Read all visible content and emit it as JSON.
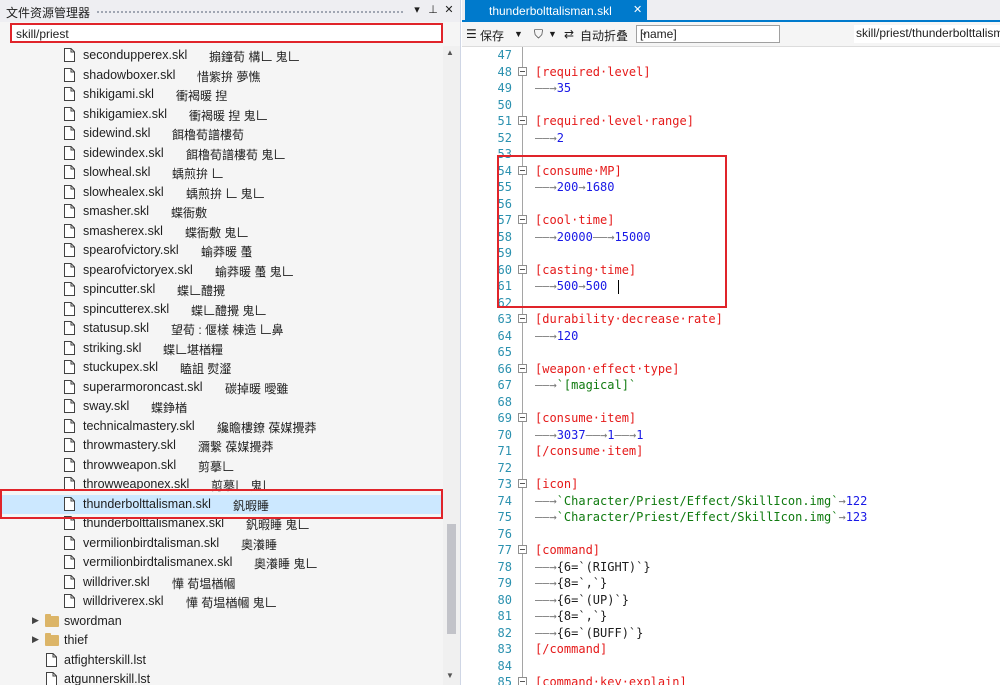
{
  "left_panel": {
    "title": "文件资源管理器",
    "search_text": "skill/priest",
    "pin_icon": "pin-icon",
    "close_icon": "close-icon",
    "items": [
      {
        "name": "secondupperex.skl",
        "desc": "搧鐘荀 構𠃊 鬼𠃊"
      },
      {
        "name": "shadowboxer.skl",
        "desc": "惜紫拚 夢憔"
      },
      {
        "name": "shikigami.skl",
        "desc": "衝褐暖 揑"
      },
      {
        "name": "shikigamiex.skl",
        "desc": "衝褐暖 揑 鬼𠃊"
      },
      {
        "name": "sidewind.skl",
        "desc": "餌橹荀譜樓荀"
      },
      {
        "name": "sidewindex.skl",
        "desc": "餌橹荀譜樓荀 鬼𠃊"
      },
      {
        "name": "slowheal.skl",
        "desc": "蝺煎拚 𠃊"
      },
      {
        "name": "slowhealex.skl",
        "desc": "蝺煎拚 𠃊 鬼𠃊"
      },
      {
        "name": "smasher.skl",
        "desc": "蝶衙敷"
      },
      {
        "name": "smasherex.skl",
        "desc": "蝶衙敷 鬼𠃊"
      },
      {
        "name": "spearofvictory.skl",
        "desc": "蝓莽暖 蠆"
      },
      {
        "name": "spearofvictoryex.skl",
        "desc": "蝓莽暖 蠆 鬼𠃊"
      },
      {
        "name": "spincutter.skl",
        "desc": "蝶𠃊醴攪"
      },
      {
        "name": "spincutterex.skl",
        "desc": "蝶𠃊醴攪 鬼𠃊"
      },
      {
        "name": "statusup.skl",
        "desc": "望荀 : 偃樣 棟造 𠃊鼻"
      },
      {
        "name": "striking.skl",
        "desc": "蝶𠃊堪楢糧"
      },
      {
        "name": "stuckupex.skl",
        "desc": "瞌詛 熨瀣"
      },
      {
        "name": "superarmoroncast.skl",
        "desc": "碳掉暖 曖雖"
      },
      {
        "name": "sway.skl",
        "desc": "蝶錚楢"
      },
      {
        "name": "technicalmastery.skl",
        "desc": "纔瞻樓鐐 葆媒攪莽"
      },
      {
        "name": "throwmastery.skl",
        "desc": "瀰繫 葆媒攪莽"
      },
      {
        "name": "throwweapon.skl",
        "desc": "剪摹𠃊"
      },
      {
        "name": "throwweaponex.skl",
        "desc": "剪摹𠃊 鬼𠃊"
      },
      {
        "name": "thunderbolttalisman.skl",
        "desc": "釩暇睡"
      },
      {
        "name": "thunderbolttalismanex.skl",
        "desc": "釩暇睡 鬼𠃊"
      },
      {
        "name": "vermilionbirdtalisman.skl",
        "desc": "奧瀁睡"
      },
      {
        "name": "vermilionbirdtalismanex.skl",
        "desc": "奧瀁睡 鬼𠃊"
      },
      {
        "name": "willdriver.skl",
        "desc": "㦊 荀塭楢幗"
      },
      {
        "name": "willdriverex.skl",
        "desc": "㦊 荀塭楢幗 鬼𠃊"
      }
    ],
    "folders": [
      "swordman",
      "thief"
    ],
    "files_after": [
      "atfighterskill.lst",
      "atgunnerskill.lst"
    ]
  },
  "right_panel": {
    "tab_title": "thunderbolttalisman.skl",
    "tab_close_icon": "close-icon",
    "toolbar": {
      "save_label": "保存",
      "filter_icon": "filter-icon",
      "auto_fold_label": "自动折叠",
      "name_select_value": "[name]",
      "path": "skill/priest/thunderbolttalisman"
    },
    "lines": [
      {
        "n": "47",
        "fold": false,
        "tokens": []
      },
      {
        "n": "48",
        "fold": true,
        "tokens": [
          {
            "t": "[required·level]",
            "c": "kw"
          }
        ]
      },
      {
        "n": "49",
        "fold": false,
        "tokens": [
          {
            "t": "——→",
            "c": "ws"
          },
          {
            "t": "35",
            "c": "num"
          }
        ]
      },
      {
        "n": "50",
        "fold": false,
        "tokens": []
      },
      {
        "n": "51",
        "fold": true,
        "tokens": [
          {
            "t": "[required·level·range]",
            "c": "kw"
          }
        ]
      },
      {
        "n": "52",
        "fold": false,
        "tokens": [
          {
            "t": "——→",
            "c": "ws"
          },
          {
            "t": "2",
            "c": "num"
          }
        ]
      },
      {
        "n": "53",
        "fold": false,
        "tokens": []
      },
      {
        "n": "54",
        "fold": true,
        "tokens": [
          {
            "t": "[consume·MP]",
            "c": "kw"
          }
        ]
      },
      {
        "n": "55",
        "fold": false,
        "tokens": [
          {
            "t": "——→",
            "c": "ws"
          },
          {
            "t": "200",
            "c": "num"
          },
          {
            "t": "→",
            "c": "ws"
          },
          {
            "t": "1680",
            "c": "num"
          }
        ]
      },
      {
        "n": "56",
        "fold": false,
        "tokens": []
      },
      {
        "n": "57",
        "fold": true,
        "tokens": [
          {
            "t": "[cool·time]",
            "c": "kw"
          }
        ]
      },
      {
        "n": "58",
        "fold": false,
        "tokens": [
          {
            "t": "——→",
            "c": "ws"
          },
          {
            "t": "20000",
            "c": "num"
          },
          {
            "t": "——→",
            "c": "ws"
          },
          {
            "t": "15000",
            "c": "num"
          }
        ]
      },
      {
        "n": "59",
        "fold": false,
        "tokens": []
      },
      {
        "n": "60",
        "fold": true,
        "tokens": [
          {
            "t": "[casting·time]",
            "c": "kw"
          }
        ]
      },
      {
        "n": "61",
        "fold": false,
        "tokens": [
          {
            "t": "——→",
            "c": "ws"
          },
          {
            "t": "500",
            "c": "num"
          },
          {
            "t": "→",
            "c": "ws"
          },
          {
            "t": "500",
            "c": "num"
          }
        ]
      },
      {
        "n": "62",
        "fold": false,
        "tokens": []
      },
      {
        "n": "63",
        "fold": true,
        "tokens": [
          {
            "t": "[durability·decrease·rate]",
            "c": "kw"
          }
        ]
      },
      {
        "n": "64",
        "fold": false,
        "tokens": [
          {
            "t": "——→",
            "c": "ws"
          },
          {
            "t": "120",
            "c": "num"
          }
        ]
      },
      {
        "n": "65",
        "fold": false,
        "tokens": []
      },
      {
        "n": "66",
        "fold": true,
        "tokens": [
          {
            "t": "[weapon·effect·type]",
            "c": "kw"
          }
        ]
      },
      {
        "n": "67",
        "fold": false,
        "tokens": [
          {
            "t": "——→",
            "c": "ws"
          },
          {
            "t": "`[magical]`",
            "c": "str"
          }
        ]
      },
      {
        "n": "68",
        "fold": false,
        "tokens": []
      },
      {
        "n": "69",
        "fold": true,
        "tokens": [
          {
            "t": "[consume·item]",
            "c": "kw"
          }
        ]
      },
      {
        "n": "70",
        "fold": false,
        "tokens": [
          {
            "t": "——→",
            "c": "ws"
          },
          {
            "t": "3037",
            "c": "num"
          },
          {
            "t": "——→",
            "c": "ws"
          },
          {
            "t": "1",
            "c": "num"
          },
          {
            "t": "——→",
            "c": "ws"
          },
          {
            "t": "1",
            "c": "num"
          }
        ]
      },
      {
        "n": "71",
        "fold": false,
        "tokens": [
          {
            "t": "[/consume·item]",
            "c": "kw"
          }
        ]
      },
      {
        "n": "72",
        "fold": false,
        "tokens": []
      },
      {
        "n": "73",
        "fold": true,
        "tokens": [
          {
            "t": "[icon]",
            "c": "kw"
          }
        ]
      },
      {
        "n": "74",
        "fold": false,
        "tokens": [
          {
            "t": "——→",
            "c": "ws"
          },
          {
            "t": "`Character/Priest/Effect/SkillIcon.img`",
            "c": "str"
          },
          {
            "t": "→",
            "c": "ws"
          },
          {
            "t": "122",
            "c": "num"
          }
        ]
      },
      {
        "n": "75",
        "fold": false,
        "tokens": [
          {
            "t": "——→",
            "c": "ws"
          },
          {
            "t": "`Character/Priest/Effect/SkillIcon.img`",
            "c": "str"
          },
          {
            "t": "→",
            "c": "ws"
          },
          {
            "t": "123",
            "c": "num"
          }
        ]
      },
      {
        "n": "76",
        "fold": false,
        "tokens": []
      },
      {
        "n": "77",
        "fold": true,
        "tokens": [
          {
            "t": "[command]",
            "c": "kw"
          }
        ]
      },
      {
        "n": "78",
        "fold": false,
        "tokens": [
          {
            "t": "——→",
            "c": "ws"
          },
          {
            "t": "{6=`(RIGHT)`}",
            "c": "def"
          }
        ]
      },
      {
        "n": "79",
        "fold": false,
        "tokens": [
          {
            "t": "——→",
            "c": "ws"
          },
          {
            "t": "{8=`,`}",
            "c": "def"
          }
        ]
      },
      {
        "n": "80",
        "fold": false,
        "tokens": [
          {
            "t": "——→",
            "c": "ws"
          },
          {
            "t": "{6=`(UP)`}",
            "c": "def"
          }
        ]
      },
      {
        "n": "81",
        "fold": false,
        "tokens": [
          {
            "t": "——→",
            "c": "ws"
          },
          {
            "t": "{8=`,`}",
            "c": "def"
          }
        ]
      },
      {
        "n": "82",
        "fold": false,
        "tokens": [
          {
            "t": "——→",
            "c": "ws"
          },
          {
            "t": "{6=`(BUFF)`}",
            "c": "def"
          }
        ]
      },
      {
        "n": "83",
        "fold": false,
        "tokens": [
          {
            "t": "[/command]",
            "c": "kw"
          }
        ]
      },
      {
        "n": "84",
        "fold": false,
        "tokens": []
      },
      {
        "n": "85",
        "fold": true,
        "tokens": [
          {
            "t": "[command·key·explain]",
            "c": "kw"
          }
        ]
      }
    ]
  },
  "colors": {
    "accent": "#007acc",
    "highlight_frame": "#e0242a",
    "keyword": "#e51a1a",
    "number": "#1919e6",
    "string": "#0f7a0f",
    "line_number": "#2b91af",
    "selection": "#cce8ff"
  }
}
